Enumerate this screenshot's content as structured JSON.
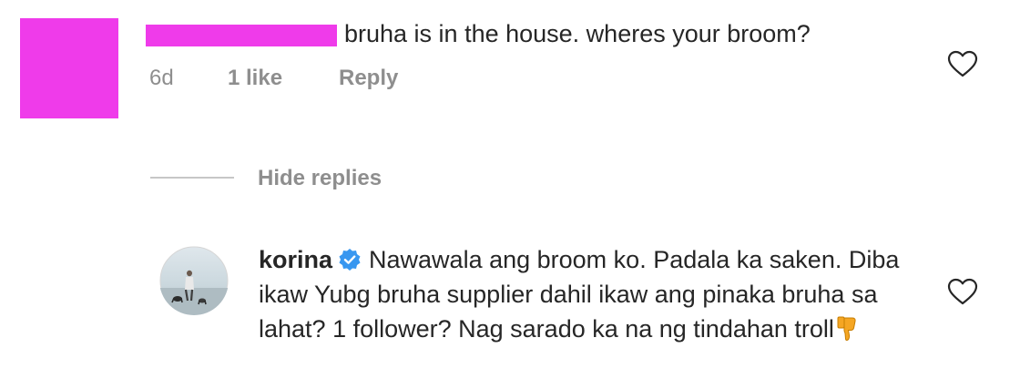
{
  "comment": {
    "text": "bruha is in the house. wheres your broom?",
    "age": "6d",
    "likes": "1 like",
    "reply_label": "Reply",
    "redaction_color": "#ef3bea"
  },
  "hide_replies_label": "Hide replies",
  "reply": {
    "username": "korina",
    "verified_icon": "verified-badge",
    "text": "Nawawala ang broom ko. Padala ka saken. Diba ikaw Yubg bruha supplier dahil ikaw ang pinaka bruha sa lahat? 1 follower? Nag sarado ka na ng tindahan troll",
    "emoji": "thumbs-down"
  },
  "colors": {
    "text": "#262626",
    "muted": "#8e8e8e",
    "verified": "#3897f0",
    "emoji": "#f5a623"
  }
}
